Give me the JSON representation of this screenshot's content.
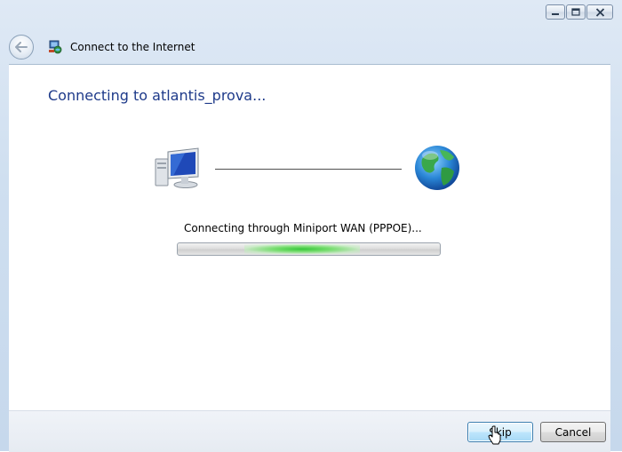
{
  "window": {
    "title": "Connect to the Internet",
    "caption_buttons": {
      "minimize_icon": "minimize-icon",
      "maximize_icon": "maximize-icon",
      "close_icon": "close-icon"
    }
  },
  "navigation": {
    "back_icon": "back-arrow-icon"
  },
  "main": {
    "heading": "Connecting to atlantis_prova...",
    "status_text": "Connecting through Miniport WAN (PPPOE)...",
    "diagram": {
      "left_icon": "computer-icon",
      "right_icon": "globe-icon"
    },
    "progress": {
      "style": "indeterminate-marquee",
      "color": "#36c63a"
    }
  },
  "footer": {
    "skip_label": "Skip",
    "cancel_label": "Cancel"
  },
  "colors": {
    "heading": "#1e3a8a",
    "default_button_border": "#3c7fb1",
    "titlebar": "#cfdff0"
  }
}
